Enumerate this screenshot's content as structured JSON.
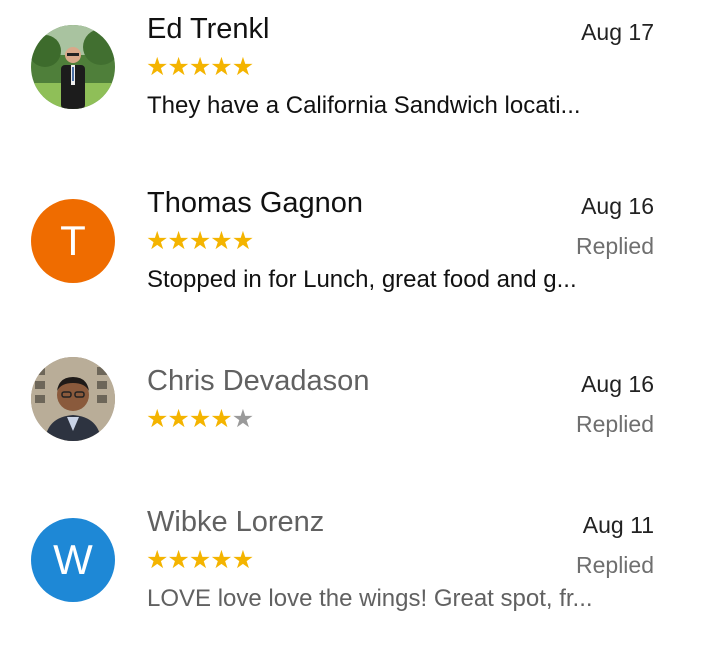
{
  "reviews": [
    {
      "name": "Ed Trenkl",
      "date": "Aug 17",
      "rating": 5,
      "replied": "",
      "snippet": "They have a California Sandwich locati...",
      "avatar": {
        "type": "photo",
        "icon": "person-photo"
      }
    },
    {
      "name": "Thomas Gagnon",
      "date": "Aug 16",
      "rating": 5,
      "replied": "Replied",
      "snippet": "Stopped in for Lunch, great food and g...",
      "avatar": {
        "type": "letter",
        "letter": "T",
        "color": "#ef6c00"
      }
    },
    {
      "name": "Chris Devadason",
      "date": "Aug 16",
      "rating": 4,
      "replied": "Replied",
      "snippet": "",
      "avatar": {
        "type": "photo",
        "icon": "person-photo"
      }
    },
    {
      "name": "Wibke Lorenz",
      "date": "Aug 11",
      "rating": 5,
      "replied": "Replied",
      "snippet": "LOVE love love the wings! Great spot, fr...",
      "avatar": {
        "type": "letter",
        "letter": "W",
        "color": "#1e88d6"
      }
    }
  ],
  "colors": {
    "star_filled": "#f4b400",
    "star_empty": "#9a9a9a",
    "replied_text": "#6f6f6f"
  }
}
